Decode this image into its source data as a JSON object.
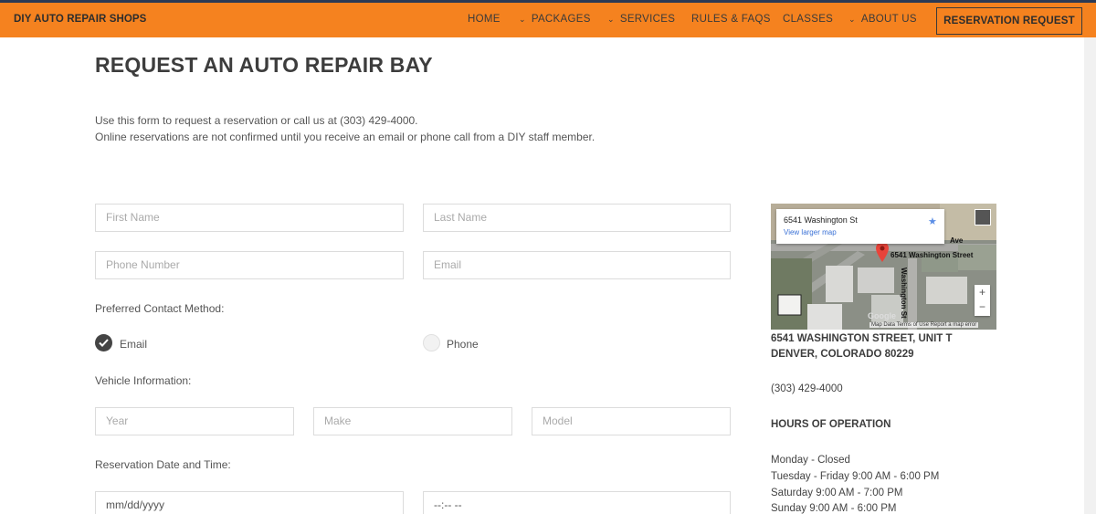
{
  "nav": {
    "brand": "DIY AUTO REPAIR SHOPS",
    "items": [
      "HOME",
      "PACKAGES",
      "SERVICES",
      "RULES & FAQS",
      "CLASSES",
      "ABOUT US"
    ],
    "cta": "RESERVATION REQUEST",
    "accent": "#f5821f"
  },
  "page": {
    "title": "REQUEST AN AUTO REPAIR BAY",
    "intro_1": "Use this form to request a reservation or call us at (303) 429-4000.",
    "intro_2": "Online reservations are not confirmed until you receive an email or phone call from a DIY staff member."
  },
  "form": {
    "first_name": "First Name",
    "last_name": "Last Name",
    "phone": "Phone Number",
    "email": "Email",
    "contact_label": "Preferred Contact Method:",
    "contact_email": "Email",
    "contact_phone": "Phone",
    "contact_selected": "Email",
    "vehicle_label": "Vehicle Information:",
    "year": "Year",
    "make": "Make",
    "model": "Model",
    "datetime_label": "Reservation Date and Time:",
    "date": "mm/dd/yyyy",
    "time": "--:-- --"
  },
  "map": {
    "address": "6541 Washington St",
    "view_larger": "View larger map",
    "street_label": "6541 Washington Street",
    "cross_street": "Washington St",
    "ave_label": "Ave",
    "google": "Google",
    "footer": "Map Data   Terms of Use   Report a map error",
    "zoom_in": "+",
    "zoom_out": "−"
  },
  "sidebar": {
    "address_1": "6541 WASHINGTON STREET, UNIT T",
    "address_2": "DENVER, COLORADO 80229",
    "phone": "(303) 429-4000",
    "hours_title": "HOURS OF OPERATION",
    "hours": [
      "Monday - Closed",
      "Tuesday - Friday 9:00 AM - 6:00 PM",
      "Saturday 9:00 AM - 7:00 PM",
      "Sunday 9:00 AM - 6:00 PM"
    ]
  }
}
